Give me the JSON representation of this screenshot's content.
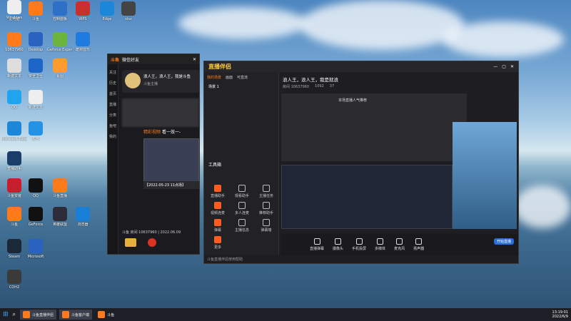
{
  "desktop_icons": [
    {
      "label": "此电脑",
      "color": "#3d8fdd"
    },
    {
      "label": "斗鱼",
      "color": "#ff7a1a"
    },
    {
      "label": "控制面板",
      "color": "#2e6fc8"
    },
    {
      "label": "WPS",
      "color": "#c9302c"
    },
    {
      "label": "Edge",
      "color": "#1c86d9"
    },
    {
      "label": "xlsx",
      "color": "#444"
    },
    {
      "label": "10637960",
      "color": "#ff7a1a"
    },
    {
      "label": "Desktop",
      "color": "#2a62c0"
    },
    {
      "label": "Geforce Experience",
      "color": "#6cb33e"
    },
    {
      "label": "酷狗音乐",
      "color": "#1f7be0"
    },
    {
      "label": "新建文本",
      "color": "#ddd"
    },
    {
      "label": "安全卫士",
      "color": "#1d66c8"
    },
    {
      "label": "看图",
      "color": "#ff9b2f"
    },
    {
      "label": "QQ",
      "color": "#1fa4f0"
    },
    {
      "label": "新建文本",
      "color": "#eee"
    },
    {
      "label": "Microsoft Edge",
      "color": "#1c86d9"
    },
    {
      "label": "天气",
      "color": "#2493e6"
    },
    {
      "label": "直播助手",
      "color": "#1a3d6a"
    },
    {
      "label": "斗鱼安装",
      "color": "#c71e2d"
    },
    {
      "label": "QQ",
      "color": "#111"
    },
    {
      "label": "斗鱼直播",
      "color": "#ff7a1a"
    },
    {
      "label": "斗鱼",
      "color": "#ff7a1a"
    },
    {
      "label": "GeForce",
      "color": "#111"
    },
    {
      "label": "英雄联盟",
      "color": "#2b2d3a"
    },
    {
      "label": "浏览器",
      "color": "#1a7fd8"
    },
    {
      "label": "Steam",
      "color": "#1b2838"
    },
    {
      "label": "Microsoft",
      "color": "#2a62c0"
    },
    {
      "label": "COH2",
      "color": "#3a3a3a"
    },
    {
      "label": "Windows",
      "color": "#eee"
    }
  ],
  "douyu_window": {
    "title": "斗鱼",
    "tab": "微信好友",
    "card_title": "浪人王，浪人王，我是斗鱼",
    "card_sub": "斗鱼主播",
    "highlight_label": "精彩视频",
    "highlight_text": "看一效一-",
    "video_caption": "【2022-05-23 11点场】",
    "footer_text": "斗鱼 房间 10637960 | 2022.06.09",
    "side_items": [
      "关注",
      "历史",
      "首页",
      "直播",
      "分类",
      "鱼吧",
      "我的"
    ]
  },
  "assistant_window": {
    "logo": "直播伴侣",
    "stream_title": "浪人王，浪人王，我是就浪",
    "room_label": "房间 10637960",
    "stats": [
      "1092",
      "37"
    ],
    "tabs": [
      "我的场景",
      "画面",
      "可直流"
    ],
    "scene": "场景 1",
    "toolbox_title": "工具箱",
    "tools": [
      "直播助手",
      "观看助手",
      "主播任务",
      "视频连麦",
      "多人连麦",
      "推荐助手",
      "弹幕",
      "主播信息",
      "弹幕墙",
      "更多"
    ],
    "preview_label": "本场直播人气推荐",
    "bottom_buttons": [
      "直播弹幕",
      "摄像头",
      "手机投屏",
      "多媒体",
      "麦克风",
      "扬声器"
    ],
    "start_button": "开始直播",
    "footer": "斗鱼直播伴侣使用帮助"
  },
  "taskbar": {
    "apps": [
      "斗鱼直播伴侣",
      "斗鱼客户端",
      "斗鱼"
    ],
    "time": "13:19:01",
    "date": "2022/6/9"
  }
}
